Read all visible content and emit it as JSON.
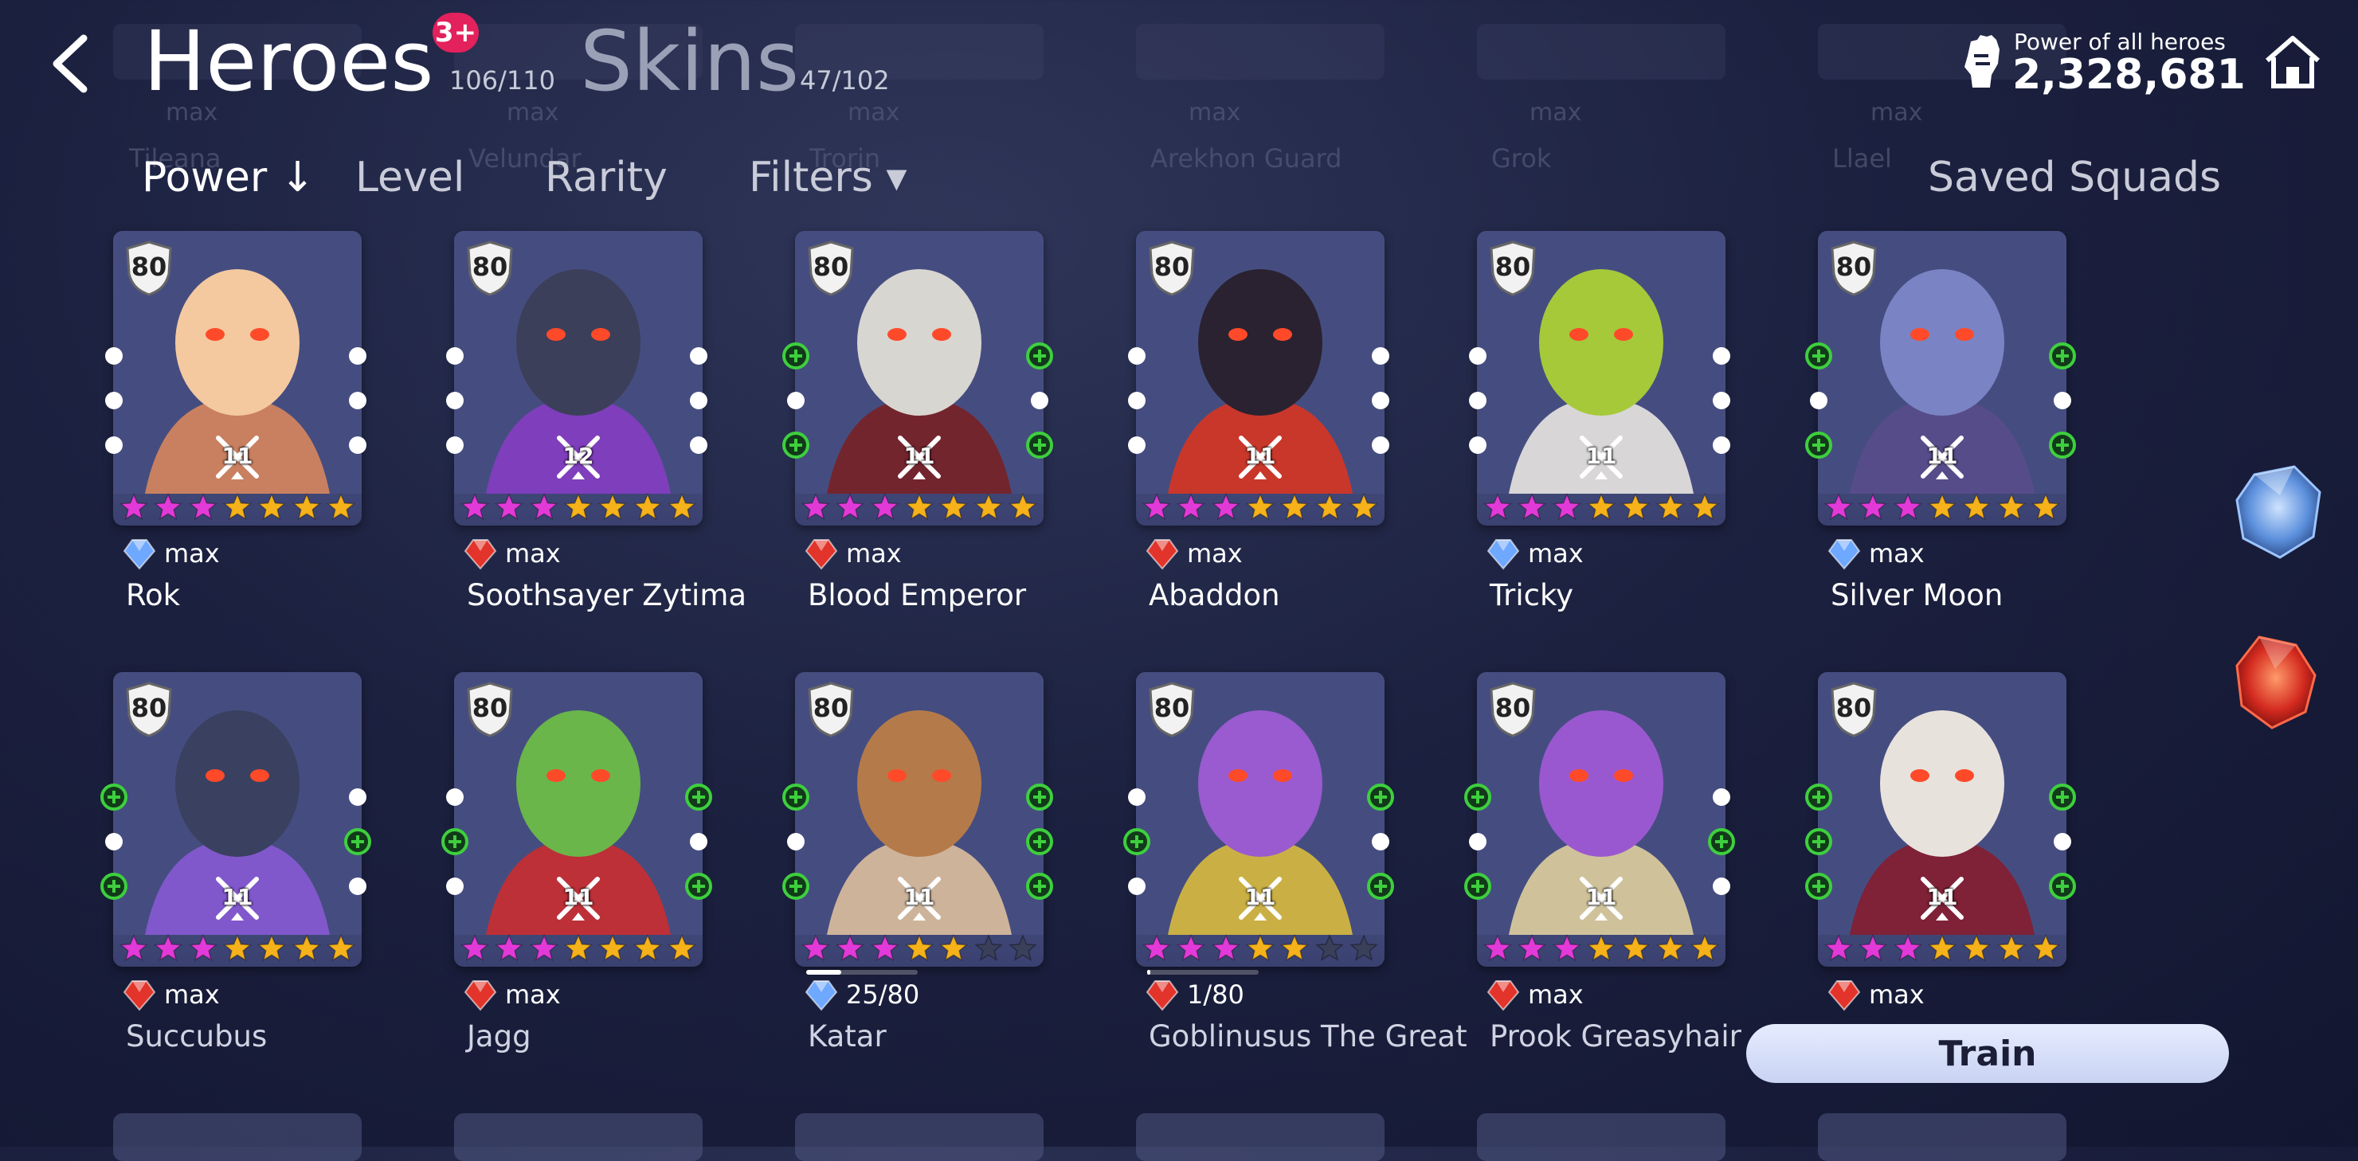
{
  "header": {
    "tab_heroes": "Heroes",
    "heroes_count": "106/110",
    "badge": "3+",
    "tab_skins": "Skins",
    "skins_count": "47/102",
    "power_label": "Power of all heroes",
    "power_value": "2,328,681"
  },
  "ghost_row": [
    {
      "max": "max",
      "name": "Tileana"
    },
    {
      "max": "max",
      "name": "Velundar"
    },
    {
      "max": "max",
      "name": "Trorin"
    },
    {
      "max": "max",
      "name": "Arekhon Guard"
    },
    {
      "max": "max",
      "name": "Grok"
    },
    {
      "max": "max",
      "name": "Llael"
    }
  ],
  "sort": {
    "power": "Power ↓",
    "level": "Level",
    "rarity": "Rarity",
    "filters": "Filters ▾",
    "saved_squads": "Saved Squads"
  },
  "heroes": [
    {
      "name": "Rok",
      "level": "80",
      "rank": "11",
      "element": "blue",
      "progress": "max",
      "stars_pink": 3,
      "stars_gold": 4,
      "stars_empty": 0
    },
    {
      "name": "Soothsayer Zytima",
      "level": "80",
      "rank": "12",
      "element": "red",
      "progress": "max",
      "stars_pink": 3,
      "stars_gold": 4,
      "stars_empty": 0
    },
    {
      "name": "Blood Emperor",
      "level": "80",
      "rank": "11",
      "element": "red",
      "progress": "max",
      "stars_pink": 3,
      "stars_gold": 4,
      "stars_empty": 0
    },
    {
      "name": "Abaddon",
      "level": "80",
      "rank": "11",
      "element": "red",
      "progress": "max",
      "stars_pink": 3,
      "stars_gold": 4,
      "stars_empty": 0
    },
    {
      "name": "Tricky",
      "level": "80",
      "rank": "11",
      "element": "blue",
      "progress": "max",
      "stars_pink": 3,
      "stars_gold": 4,
      "stars_empty": 0
    },
    {
      "name": "Silver Moon",
      "level": "80",
      "rank": "11",
      "element": "blue",
      "progress": "max",
      "stars_pink": 3,
      "stars_gold": 4,
      "stars_empty": 0
    },
    {
      "name": "Succubus",
      "level": "80",
      "rank": "11",
      "element": "red",
      "progress": "max",
      "stars_pink": 3,
      "stars_gold": 4,
      "stars_empty": 0
    },
    {
      "name": "Jagg",
      "level": "80",
      "rank": "11",
      "element": "red",
      "progress": "max",
      "stars_pink": 3,
      "stars_gold": 4,
      "stars_empty": 0
    },
    {
      "name": "Katar",
      "level": "80",
      "rank": "11",
      "element": "blue",
      "progress": "25/80",
      "stars_pink": 3,
      "stars_gold": 2,
      "stars_empty": 2
    },
    {
      "name": "Goblinusus The Great",
      "level": "80",
      "rank": "11",
      "element": "red",
      "progress": "1/80",
      "stars_pink": 3,
      "stars_gold": 2,
      "stars_empty": 2
    },
    {
      "name": "Prook Greasyhair",
      "level": "80",
      "rank": "11",
      "element": "red",
      "progress": "max",
      "stars_pink": 3,
      "stars_gold": 4,
      "stars_empty": 0
    },
    {
      "name": "",
      "level": "80",
      "rank": "11",
      "element": "red",
      "progress": "max",
      "stars_pink": 3,
      "stars_gold": 4,
      "stars_empty": 0
    }
  ],
  "train_button": "Train",
  "colors": {
    "background": "#1c2140",
    "card": "#4c5589",
    "star_pink": "#e23ad8",
    "star_gold": "#f6b21a",
    "plus_green": "#3ecf3e",
    "badge_red": "#e3215c",
    "crystal_blue": "#6fa8ff",
    "crystal_red": "#e2342a"
  },
  "icons": {
    "back": "chevron-left-icon",
    "power": "fist-icon",
    "home": "home-icon",
    "level_shield": "shield-icon",
    "rank": "crossed-swords-icon",
    "element_blue": "blue-crystal-icon",
    "element_red": "red-crystal-icon",
    "star": "star-icon",
    "plus_slot": "plus-circle-icon"
  }
}
